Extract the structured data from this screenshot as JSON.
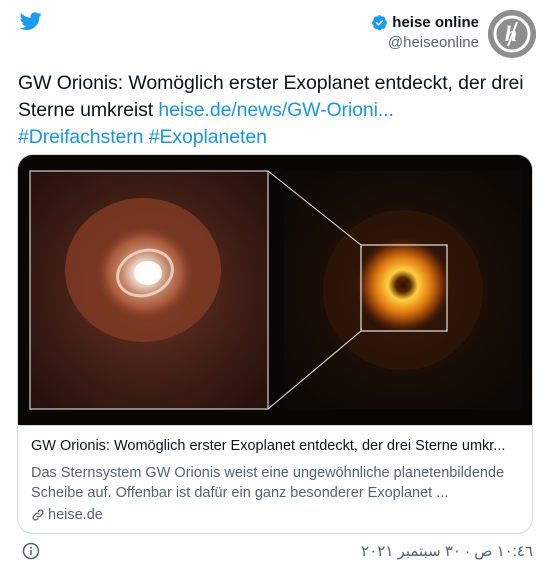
{
  "author": {
    "name": "heise online",
    "handle": "@heiseonline",
    "avatar_text": "h"
  },
  "tweet": {
    "text": "GW Orionis: Womöglich erster Exoplanet entdeckt, der drei Sterne umkreist",
    "link": "heise.de/news/GW-Orioni...",
    "hashtags": [
      "#Dreifachstern",
      "#Exoplaneten"
    ]
  },
  "card": {
    "title": "GW Orionis: Womöglich erster Exoplanet entdeckt, der drei Sterne umkr...",
    "description": "Das Sternsystem GW Orionis weist eine ungewöhnliche planetenbildende Scheibe auf. Offenbar ist dafür ein ganz besonderer Exoplanet ...",
    "domain": "heise.de"
  },
  "footer": {
    "timestamp": "١٠:٤٦ ص · ٣٠ سبتمبر ٢٠٢١"
  },
  "colors": {
    "twitter_blue": "#1d9bf0",
    "link": "#1b95e0",
    "secondary_text": "#536471"
  },
  "icons": [
    "twitter-bird-icon",
    "verified-badge-icon",
    "link-icon",
    "info-icon"
  ]
}
